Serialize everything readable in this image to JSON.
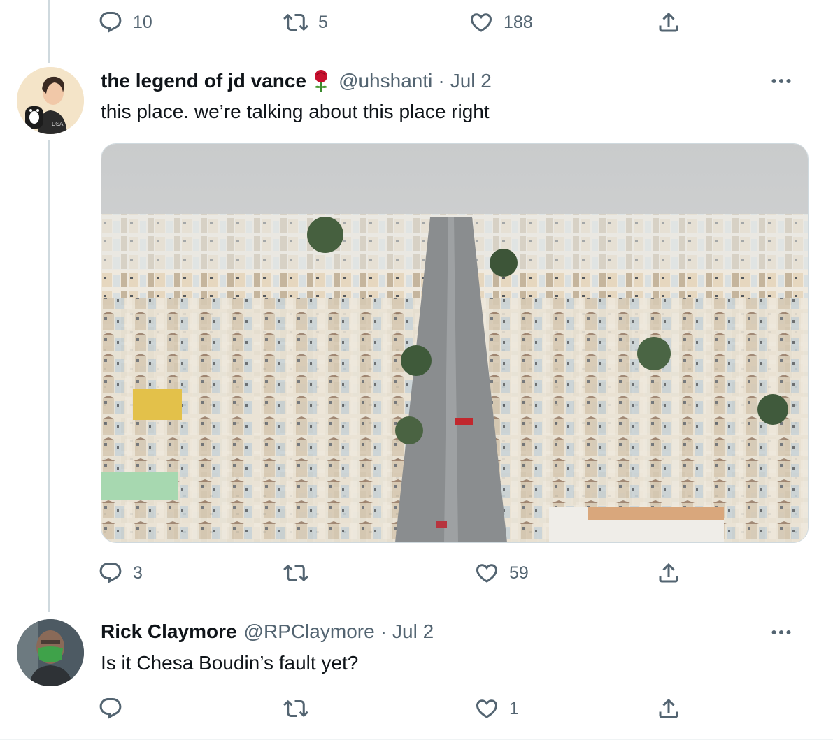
{
  "top_actions": {
    "reply_count": "10",
    "retweet_count": "5",
    "like_count": "188"
  },
  "tweet1": {
    "display_name": "the legend of jd vance",
    "handle": "@uhshanti",
    "date": "Jul 2",
    "text": "this place. we’re talking about this place right",
    "avatar_badge": "DSA",
    "reply_count": "3",
    "retweet_count": "",
    "like_count": "59"
  },
  "tweet2": {
    "display_name": "Rick Claymore",
    "handle": "@RPClaymore",
    "date": "Jul 2",
    "text": "Is it Chesa Boudin’s fault yet?",
    "reply_count": "",
    "retweet_count": "",
    "like_count": "1"
  },
  "icons": [
    "reply-icon",
    "retweet-icon",
    "like-icon",
    "share-icon",
    "more-icon",
    "rose-emoji-icon"
  ],
  "colors": {
    "text": "#0f1419",
    "secondary": "#536471",
    "border": "#cfd9de"
  }
}
